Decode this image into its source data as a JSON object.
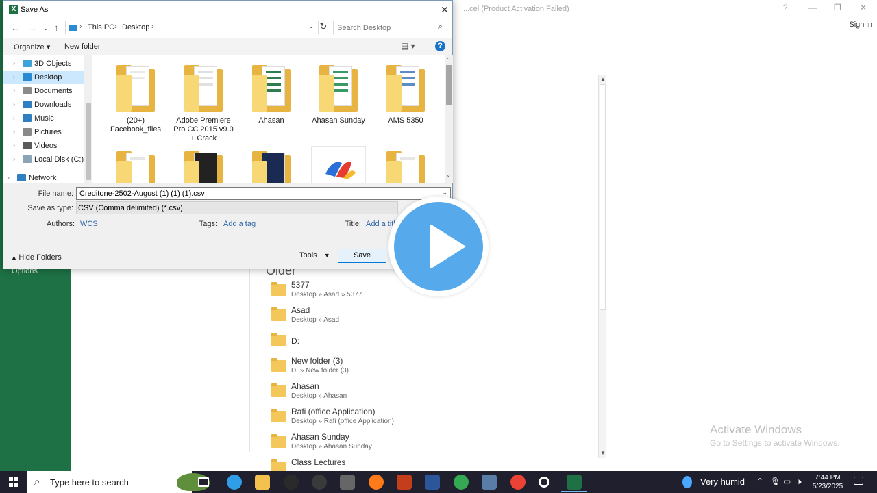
{
  "excel": {
    "title": "...cel (Product Activation Failed)",
    "sign_in": "Sign in",
    "options": "Options",
    "older_heading": "Older",
    "recent": [
      {
        "name": "5377",
        "path": "Desktop » Asad » 5377"
      },
      {
        "name": "Asad",
        "path": "Desktop » Asad"
      },
      {
        "name": "D:",
        "path": ""
      },
      {
        "name": "New folder (3)",
        "path": "D: » New folder (3)"
      },
      {
        "name": "Ahasan",
        "path": "Desktop » Ahasan"
      },
      {
        "name": "Rafi (office Application)",
        "path": "Desktop » Rafi (office Application)"
      },
      {
        "name": "Ahasan Sunday",
        "path": "Desktop » Ahasan Sunday"
      },
      {
        "name": "Class Lectures",
        "path": ""
      }
    ],
    "activate_title": "Activate Windows",
    "activate_sub": "Go to Settings to activate Windows."
  },
  "dialog": {
    "title": "Save As",
    "breadcrumb": [
      "This PC",
      "Desktop"
    ],
    "search_placeholder": "Search Desktop",
    "organize": "Organize ▾",
    "new_folder": "New folder",
    "nav_items": [
      {
        "label": "3D Objects",
        "color": "#3fa3d9"
      },
      {
        "label": "Desktop",
        "color": "#2a8ad4"
      },
      {
        "label": "Documents",
        "color": "#8a8a8a"
      },
      {
        "label": "Downloads",
        "color": "#2f7fc2"
      },
      {
        "label": "Music",
        "color": "#2f7fc2"
      },
      {
        "label": "Pictures",
        "color": "#8a8a8a"
      },
      {
        "label": "Videos",
        "color": "#5b5b5b"
      },
      {
        "label": "Local Disk (C:)",
        "color": "#8aa4b8"
      },
      {
        "label": "Network",
        "color": "#2f7fc2"
      }
    ],
    "files": [
      {
        "label": "(20+) Facebook_files"
      },
      {
        "label": "Adobe Premiere Pro CC 2015 v9.0 + Crack"
      },
      {
        "label": "Ahasan"
      },
      {
        "label": "Ahasan Sunday"
      },
      {
        "label": "AMS 5350"
      }
    ],
    "file_name_label": "File name:",
    "file_name": "Creditone-2502-August (1) (1) (1).csv",
    "save_type_label": "Save as type:",
    "save_type": "CSV (Comma delimited) (*.csv)",
    "authors_label": "Authors:",
    "authors": "WCS",
    "tags_label": "Tags:",
    "tags": "Add a tag",
    "title_label": "Title:",
    "title_value": "Add a title",
    "hide_folders": "Hide Folders",
    "tools": "Tools",
    "save": "Save"
  },
  "taskbar": {
    "search_placeholder": "Type here to search",
    "weather": "Very humid",
    "time": "7:44 PM",
    "date": "5/23/2025",
    "apps": [
      {
        "name": "task-view",
        "color": "#1f1f2e"
      },
      {
        "name": "edge",
        "color": "#2f9ee6"
      },
      {
        "name": "file-explorer",
        "color": "#f2c14e"
      },
      {
        "name": "chatgpt",
        "color": "#2a2a2a"
      },
      {
        "name": "obs",
        "color": "#3a3a3a"
      },
      {
        "name": "app",
        "color": "#666666"
      },
      {
        "name": "firefox",
        "color": "#ff7b1a"
      },
      {
        "name": "powerpoint",
        "color": "#c43e1c"
      },
      {
        "name": "word",
        "color": "#2b579a"
      },
      {
        "name": "chrome",
        "color": "#34a853"
      },
      {
        "name": "app2",
        "color": "#5a7da8"
      },
      {
        "name": "chrome-2",
        "color": "#ea4335"
      },
      {
        "name": "settings",
        "color": "#1f1f2e"
      },
      {
        "name": "excel",
        "color": "#1e7145"
      }
    ]
  }
}
